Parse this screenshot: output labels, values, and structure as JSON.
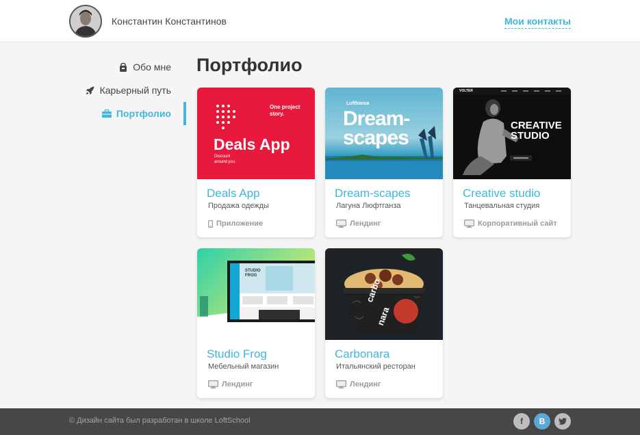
{
  "header": {
    "user_name": "Константин Константинов",
    "contacts_link": "Мои контакты"
  },
  "sidebar": {
    "items": [
      {
        "label": "Обо мне",
        "icon": "bag-icon"
      },
      {
        "label": "Карьерный путь",
        "icon": "rocket-icon"
      },
      {
        "label": "Портфолио",
        "icon": "briefcase-icon",
        "active": true
      }
    ]
  },
  "main": {
    "title": "Портфолио",
    "projects": [
      {
        "title": "Deals App",
        "subtitle": "Продажа одежды",
        "type": "Приложение",
        "type_icon": "mobile-icon",
        "thumb": {
          "brand_line1": "One project",
          "brand_line2": "story.",
          "heading": "Deals App",
          "tag_line1": "Discount",
          "tag_line2": "around you."
        }
      },
      {
        "title": "Dream-scapes",
        "subtitle": "Лагуна Люфтганза",
        "type": "Лендинг",
        "type_icon": "monitor-icon",
        "thumb": {
          "brand": "Lufthansa",
          "line1": "Dream-",
          "line2": "scapes"
        }
      },
      {
        "title": "Creative studio",
        "subtitle": "Танцевальная студия",
        "type": "Корпоративный сайт",
        "type_icon": "monitor-icon",
        "thumb": {
          "logo": "VOLTER",
          "line1": "CREATIVE",
          "line2": "STUDIO"
        }
      },
      {
        "title": "Studio Frog",
        "subtitle": "Мебельный магазин",
        "type": "Лендинг",
        "type_icon": "monitor-icon",
        "thumb": {
          "line1": "STUDIO",
          "line2": "FROG"
        }
      },
      {
        "title": "Carbonara",
        "subtitle": "Итальянский ресторан",
        "type": "Лендинг",
        "type_icon": "monitor-icon",
        "thumb": {
          "line1": "carbo",
          "line2": "nara"
        }
      }
    ]
  },
  "footer": {
    "copyright": "© Дизайн сайта был разработан в школе LoftSchool",
    "social": [
      {
        "label": "f",
        "icon": "facebook-icon"
      },
      {
        "label": "B",
        "icon": "vk-icon"
      },
      {
        "label": "",
        "icon": "twitter-icon"
      }
    ]
  },
  "colors": {
    "accent": "#3fb6dc",
    "footer_bg": "#474747",
    "deals_red": "#e8193c"
  }
}
